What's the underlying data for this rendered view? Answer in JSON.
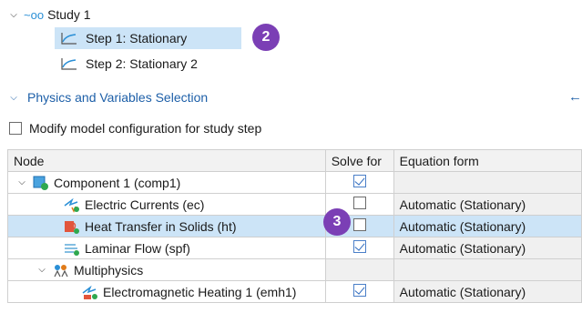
{
  "tree": {
    "study": {
      "label": "Study 1",
      "icon": "study-icon"
    },
    "steps": [
      {
        "label": "Step 1: Stationary",
        "selected": true,
        "icon": "stationary-step-icon"
      },
      {
        "label": "Step 2: Stationary 2",
        "selected": false,
        "icon": "stationary-step-icon"
      }
    ]
  },
  "badges": {
    "first": "2",
    "second": "3"
  },
  "section": {
    "title": "Physics and Variables Selection"
  },
  "modify_option": {
    "label": "Modify model configuration for study step",
    "checked": false
  },
  "table": {
    "headers": {
      "node": "Node",
      "solve": "Solve for",
      "equation": "Equation form"
    },
    "rows": [
      {
        "node": "Component 1 (comp1)",
        "solve": true,
        "equation": "",
        "icon": "component-icon"
      },
      {
        "node": "Electric Currents (ec)",
        "solve": false,
        "equation": "Automatic (Stationary)",
        "icon": "electric-currents-icon"
      },
      {
        "node": "Heat Transfer in Solids (ht)",
        "solve": false,
        "equation": "Automatic (Stationary)",
        "icon": "heat-transfer-icon",
        "selected": true
      },
      {
        "node": "Laminar Flow (spf)",
        "solve": true,
        "equation": "Automatic (Stationary)",
        "icon": "laminar-flow-icon"
      },
      {
        "node": "Multiphysics",
        "solve": null,
        "equation": "",
        "icon": "multiphysics-icon"
      },
      {
        "node": "Electromagnetic Heating 1 (emh1)",
        "solve": true,
        "equation": "Automatic (Stationary)",
        "icon": "electromagnetic-heating-icon"
      }
    ]
  },
  "colors": {
    "accent": "#1d5fa8",
    "selection": "#cce4f7",
    "badge": "#7b3fb5"
  }
}
